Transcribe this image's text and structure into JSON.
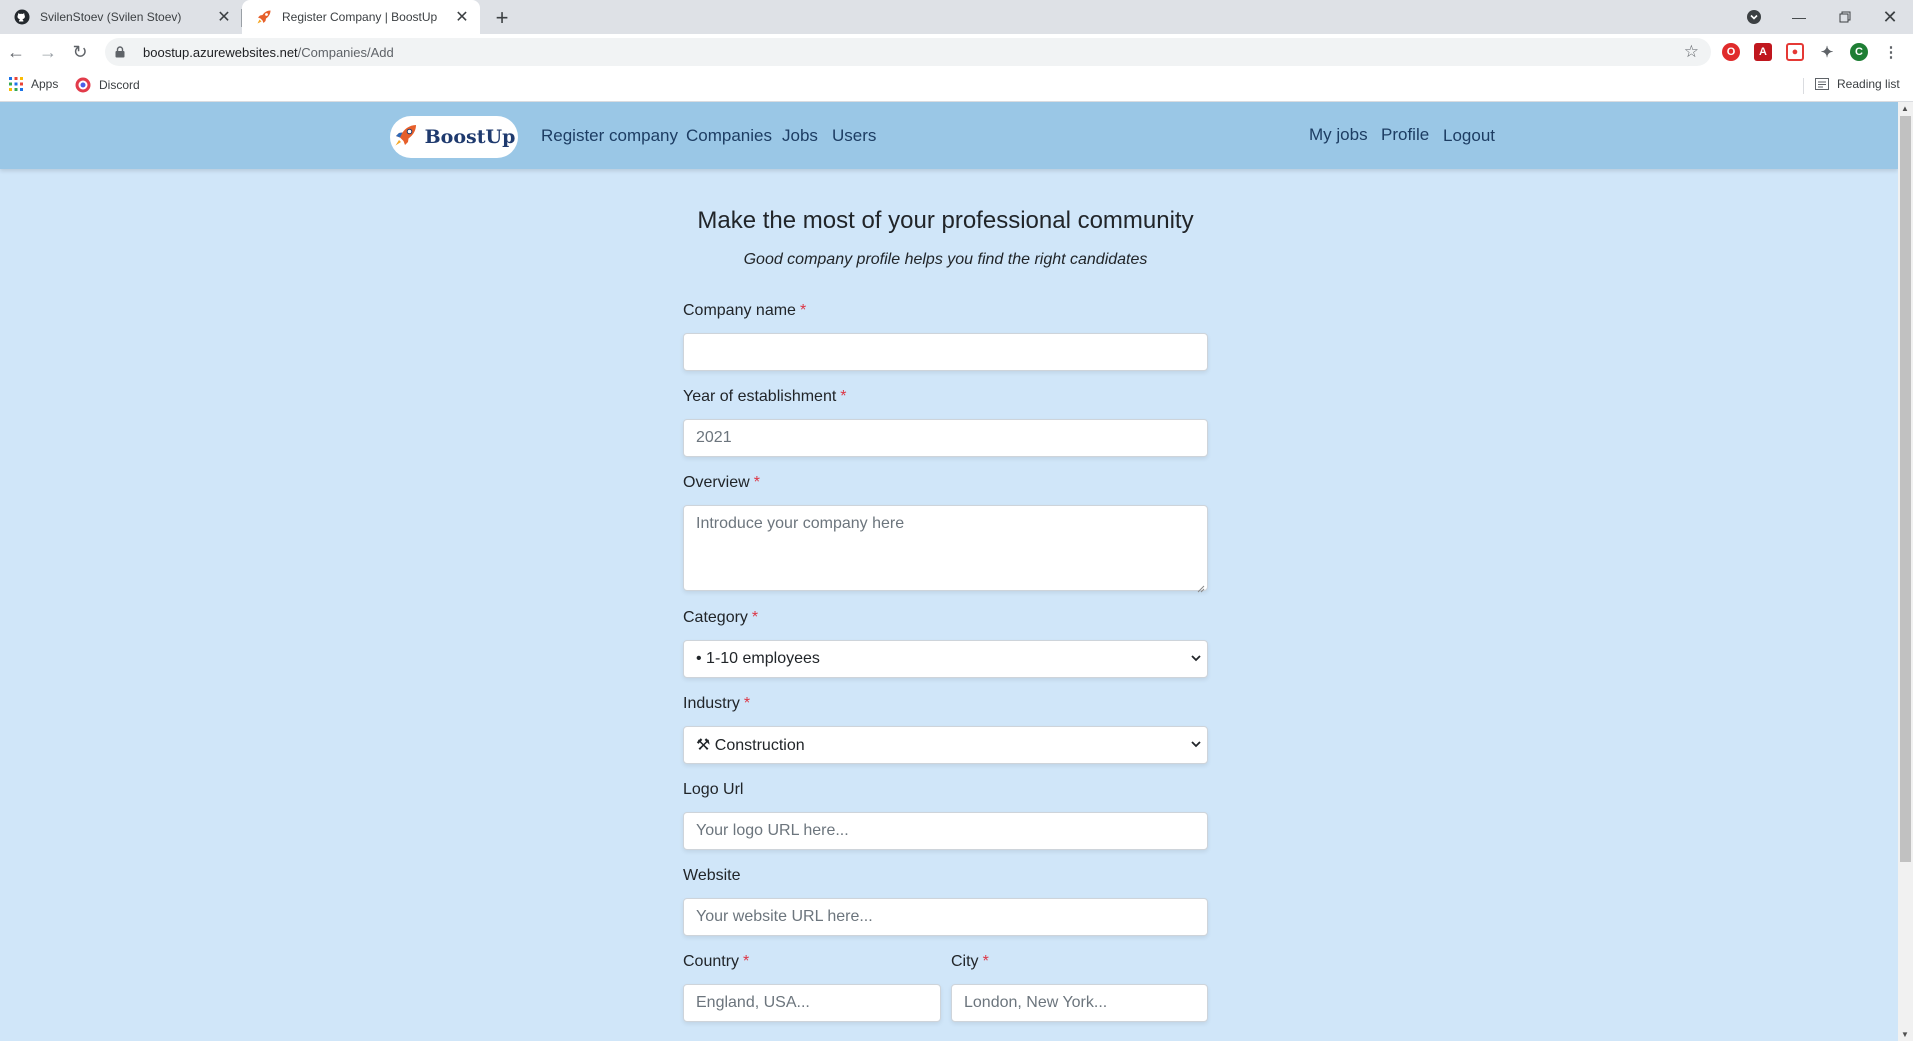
{
  "browser": {
    "tabs": [
      {
        "title": "SvilenStoev (Svilen Stoev)",
        "icon": "github-icon"
      },
      {
        "title": "Register Company | BoostUp",
        "icon": "rocket-icon"
      }
    ],
    "url_domain": "boostup.azurewebsites.net",
    "url_path": "/Companies/Add",
    "profile_initial": "C",
    "bookmarks": [
      "Apps",
      "Discord"
    ],
    "reading_list": "Reading list"
  },
  "site": {
    "brand": "BoostUp",
    "nav_left": [
      "Register company",
      "Companies",
      "Jobs",
      "Users"
    ],
    "nav_right": [
      "My jobs",
      "Profile",
      "Logout"
    ]
  },
  "form": {
    "headline": "Make the most of your professional community",
    "subheadline": "Good company profile helps you find the right candidates",
    "required_mark": "*",
    "company_name": {
      "label": "Company name",
      "value": ""
    },
    "year": {
      "label": "Year of establishment",
      "placeholder": "2021"
    },
    "overview": {
      "label": "Overview",
      "placeholder": "Introduce your company here"
    },
    "category": {
      "label": "Category",
      "selected": "• 1-10 employees"
    },
    "industry": {
      "label": "Industry",
      "selected": "⚒ Construction"
    },
    "logo_url": {
      "label": "Logo Url",
      "placeholder": "Your logo URL here..."
    },
    "website": {
      "label": "Website",
      "placeholder": "Your website URL here..."
    },
    "country": {
      "label": "Country",
      "placeholder": "England, USA..."
    },
    "city": {
      "label": "City",
      "placeholder": "London, New York..."
    }
  },
  "colors": {
    "page_bg": "#d0e6f9",
    "navbar_bg": "#9ac7e6",
    "required": "#dc3545"
  }
}
